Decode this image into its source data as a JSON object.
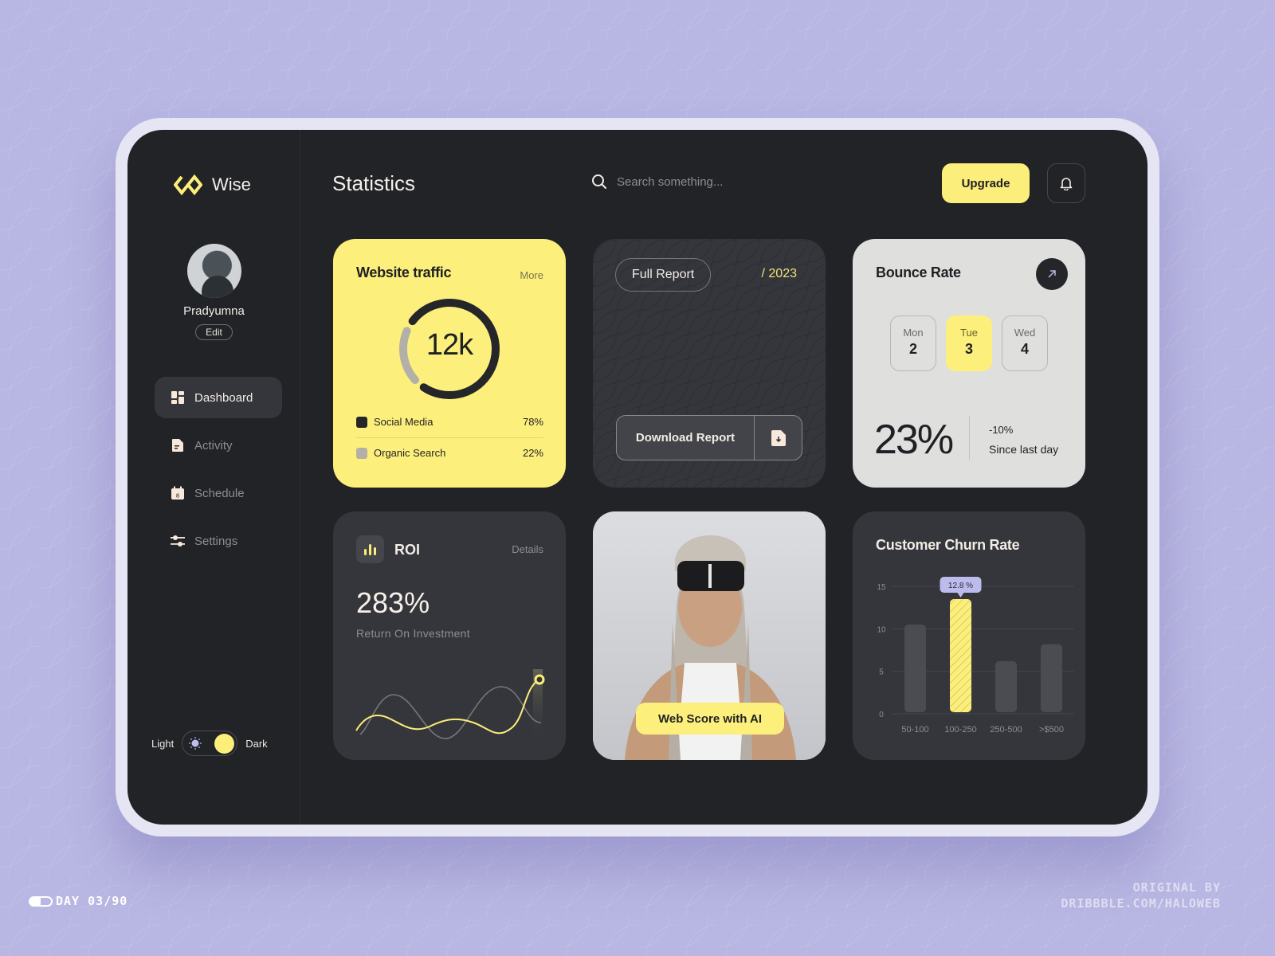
{
  "app": {
    "name": "Wise",
    "page_title": "Statistics"
  },
  "profile": {
    "name": "Pradyumna",
    "edit_label": "Edit"
  },
  "nav": {
    "items": [
      {
        "label": "Dashboard",
        "icon": "dashboard-icon",
        "active": true
      },
      {
        "label": "Activity",
        "icon": "document-icon",
        "active": false
      },
      {
        "label": "Schedule",
        "icon": "calendar-icon",
        "active": false
      },
      {
        "label": "Settings",
        "icon": "sliders-icon",
        "active": false
      }
    ]
  },
  "theme": {
    "light_label": "Light",
    "dark_label": "Dark",
    "current": "Dark"
  },
  "header": {
    "search_placeholder": "Search something...",
    "upgrade_label": "Upgrade"
  },
  "traffic": {
    "title": "Website traffic",
    "more_label": "More",
    "total": "12k",
    "sources": [
      {
        "label": "Social Media",
        "pct": "78%",
        "value": 78,
        "color": "#25262a"
      },
      {
        "label": "Organic Search",
        "pct": "22%",
        "value": 22,
        "color": "#b3b0a8"
      }
    ]
  },
  "report": {
    "full_report_label": "Full Report",
    "year": "/ 2023",
    "download_label": "Download Report"
  },
  "bounce": {
    "title": "Bounce Rate",
    "days": [
      {
        "name": "Mon",
        "num": "2",
        "active": false
      },
      {
        "name": "Tue",
        "num": "3",
        "active": true
      },
      {
        "name": "Wed",
        "num": "4",
        "active": false
      }
    ],
    "value": "23%",
    "change": "-10%",
    "since": "Since last day"
  },
  "roi": {
    "title": "ROI",
    "details_label": "Details",
    "value": "283%",
    "label": "Return On Investment"
  },
  "promo": {
    "button_label": "Web Score with AI"
  },
  "chart_data": {
    "type": "bar",
    "title": "Customer Churn Rate",
    "categories": [
      "50-100",
      "100-250",
      "250-500",
      ">$500"
    ],
    "values": [
      10.5,
      13.5,
      6.2,
      8.2
    ],
    "highlight_index": 1,
    "highlight_label": "12.8 %",
    "yticks": [
      0,
      5,
      10,
      15
    ],
    "ylim": [
      0,
      15
    ],
    "xlabel": "",
    "ylabel": "",
    "grid": true
  },
  "footer": {
    "left": "DAY 03/90",
    "right_line1": "ORIGINAL BY",
    "right_line2": "DRIBBBLE.COM/HALOWEB"
  },
  "colors": {
    "accent": "#fcee7a",
    "dark": "#222327",
    "card": "#35363b",
    "lavender": "#b8b6e2"
  }
}
